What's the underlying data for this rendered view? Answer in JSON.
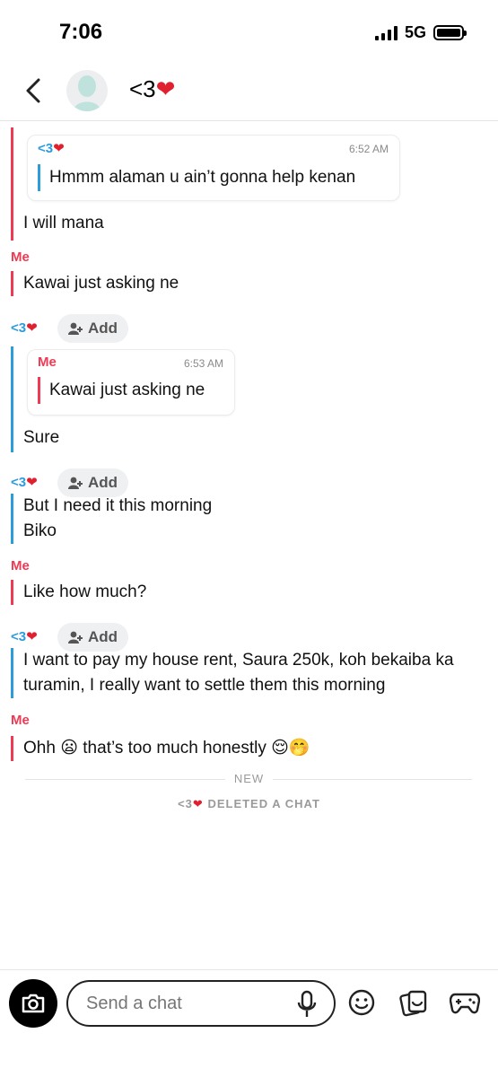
{
  "status_bar": {
    "time": "7:06",
    "network": "5G"
  },
  "header": {
    "title": "<3",
    "back_icon": "chevron-left-icon",
    "avatar_icon": "bitmoji-avatar-icon"
  },
  "chat": {
    "quote_1": {
      "sender": "<3",
      "time": "6:52 AM",
      "text": "Hmmm alaman u ain’t gonna help kenan"
    },
    "msg_1": "I will mana",
    "sender_me_1": "Me",
    "msg_2": "Kawai just asking ne",
    "sender_them_1": "<3",
    "add_label": "Add",
    "quote_2": {
      "sender": "Me",
      "time": "6:53 AM",
      "text": "Kawai just asking ne"
    },
    "msg_3": "Sure",
    "sender_them_2": "<3",
    "msg_4": "But I need it this morning",
    "msg_5": "Biko",
    "sender_me_2": "Me",
    "msg_6": "Like how much?",
    "sender_them_3": "<3",
    "msg_7_line1": "I want to pay my house rent, Saura 250k, koh bekaiba ka",
    "msg_7_line2": "turamin, I really want to settle them this morning",
    "sender_me_3": "Me",
    "msg_8": "Ohh 😦 that’s too much honestly 😌🤭",
    "new_label": "NEW",
    "deleted_prefix": "<3",
    "deleted_text": "DELETED A CHAT"
  },
  "bottom_bar": {
    "placeholder": "Send a chat"
  },
  "colors": {
    "me": "#ef3a54",
    "them": "#2d9cdb",
    "heart": "#e0202f"
  }
}
